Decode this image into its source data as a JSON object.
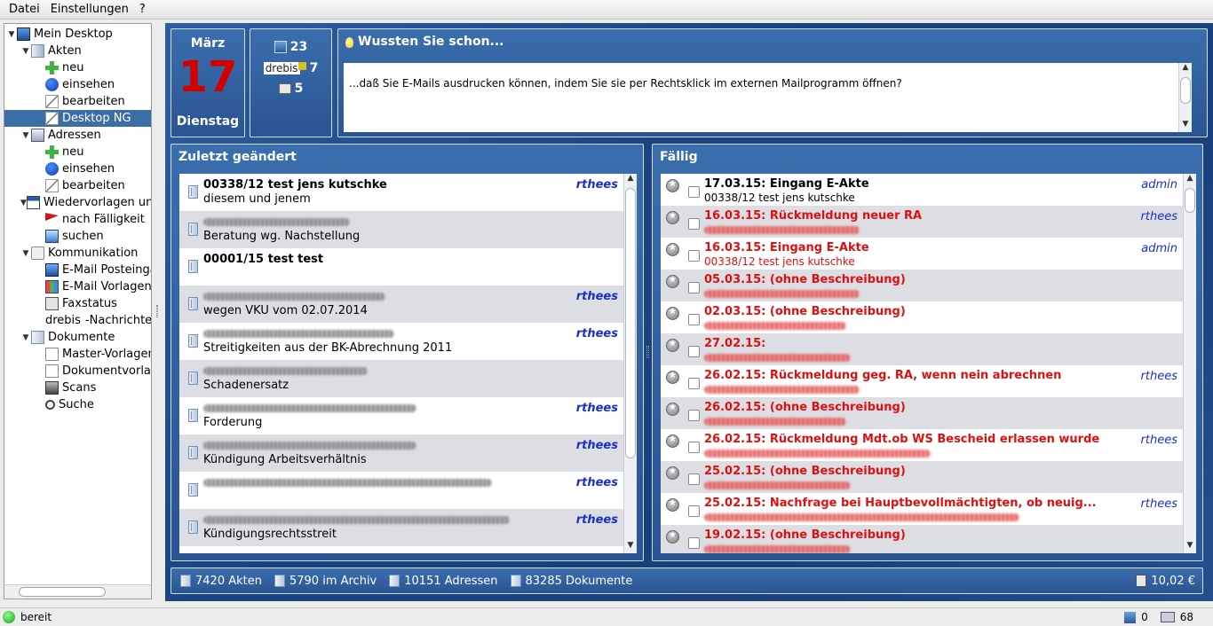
{
  "menu": {
    "items": [
      "Datei",
      "Einstellungen",
      "?"
    ]
  },
  "tree": {
    "items": [
      {
        "label": "Mein Desktop",
        "level": 0,
        "expanded": true,
        "icon": "desktop-icon"
      },
      {
        "label": "Akten",
        "level": 1,
        "expanded": true,
        "icon": "files-icon"
      },
      {
        "label": "neu",
        "level": 2,
        "icon": "add-icon"
      },
      {
        "label": "einsehen",
        "level": 2,
        "icon": "info-icon"
      },
      {
        "label": "bearbeiten",
        "level": 2,
        "icon": "edit-icon"
      },
      {
        "label": "Desktop NG",
        "level": 2,
        "icon": "edit-icon",
        "selected": true
      },
      {
        "label": "Adressen",
        "level": 1,
        "expanded": true,
        "icon": "address-icon"
      },
      {
        "label": "neu",
        "level": 2,
        "icon": "add-icon"
      },
      {
        "label": "einsehen",
        "level": 2,
        "icon": "info-icon"
      },
      {
        "label": "bearbeiten",
        "level": 2,
        "icon": "edit-icon"
      },
      {
        "label": "Wiedervorlagen und",
        "level": 1,
        "expanded": true,
        "icon": "calendar-icon"
      },
      {
        "label": "nach Fälligkeit",
        "level": 2,
        "icon": "flag-icon"
      },
      {
        "label": "suchen",
        "level": 2,
        "icon": "mail-search-icon"
      },
      {
        "label": "Kommunikation",
        "level": 1,
        "expanded": true,
        "icon": "communication-icon"
      },
      {
        "label": "E-Mail Posteingang",
        "level": 2,
        "icon": "mail-inbox-icon"
      },
      {
        "label": "E-Mail Vorlagen",
        "level": 2,
        "icon": "mail-template-icon"
      },
      {
        "label": "Faxstatus",
        "level": 2,
        "icon": "printer-icon"
      },
      {
        "label": "drebis",
        "suffix": "-Nachrichten",
        "level": 2,
        "icon": "drebis-icon"
      },
      {
        "label": "Dokumente",
        "level": 1,
        "expanded": true,
        "icon": "documents-icon"
      },
      {
        "label": "Master-Vorlagen",
        "level": 2,
        "icon": "document-icon"
      },
      {
        "label": "Dokumentvorlagen",
        "level": 2,
        "icon": "document-icon"
      },
      {
        "label": "Scans",
        "level": 2,
        "icon": "scanner-icon"
      },
      {
        "label": "Suche",
        "level": 2,
        "icon": "search-icon"
      }
    ]
  },
  "date": {
    "month": "März",
    "day": "17",
    "weekday": "Dienstag"
  },
  "counts": {
    "inbox": "23",
    "drebis_label": "drebis",
    "drebis": "7",
    "print": "5"
  },
  "tip": {
    "title": "Wussten Sie schon...",
    "text": "...daß Sie E-Mails ausdrucken können, indem Sie sie per Rechtsklick im externen Mailprogramm öffnen?"
  },
  "recent": {
    "title": "Zuletzt geändert",
    "rows": [
      {
        "title": "00338/12 test jens kutschke",
        "subtitle": "diesem und jenem",
        "user": "rthees",
        "title_blurred": false,
        "title_blur_width": 0
      },
      {
        "title": "",
        "subtitle": "Beratung wg. Nachstellung",
        "user": "",
        "title_blurred": true,
        "title_blur_width": 165
      },
      {
        "title": "00001/15 test test",
        "subtitle": "",
        "user": "",
        "title_blurred": false,
        "title_blur_width": 0
      },
      {
        "title": "",
        "subtitle": "wegen VKU vom 02.07.2014",
        "user": "rthees",
        "title_blurred": true,
        "title_blur_width": 205
      },
      {
        "title": "",
        "subtitle": "Streitigkeiten aus der BK-Abrechnung 2011",
        "user": "rthees",
        "title_blurred": true,
        "title_blur_width": 215
      },
      {
        "title": "",
        "subtitle": "Schadenersatz",
        "user": "",
        "title_blurred": true,
        "title_blur_width": 185
      },
      {
        "title": "",
        "subtitle": "Forderung",
        "user": "rthees",
        "title_blurred": true,
        "title_blur_width": 240
      },
      {
        "title": "",
        "subtitle": "Kündigung Arbeitsverhältnis",
        "user": "rthees",
        "title_blurred": true,
        "title_blur_width": 240
      },
      {
        "title": "",
        "subtitle": "",
        "user": "rthees",
        "title_blurred": true,
        "title_blur_width": 325
      },
      {
        "title": "",
        "subtitle": "Kündigungsrechtsstreit",
        "user": "rthees",
        "title_blurred": true,
        "title_blur_width": 345
      }
    ]
  },
  "due": {
    "title": "Fällig",
    "rows": [
      {
        "title": "17.03.15: Eingang E-Akte",
        "subtitle": "00338/12 test jens kutschke",
        "user": "admin",
        "red": false,
        "subtitle_blurred": false,
        "blur_width": 0
      },
      {
        "title": "16.03.15: Rückmeldung neuer RA",
        "subtitle": "",
        "user": "rthees",
        "red": true,
        "subtitle_blurred": true,
        "blur_width": 175
      },
      {
        "title": "16.03.15: Eingang E-Akte",
        "subtitle": "00338/12 test jens kutschke",
        "user": "admin",
        "red": true,
        "subtitle_blurred": false,
        "blur_width": 0
      },
      {
        "title": "05.03.15: (ohne Beschreibung)",
        "subtitle": "",
        "user": "",
        "red": true,
        "subtitle_blurred": true,
        "blur_width": 175
      },
      {
        "title": "02.03.15: (ohne Beschreibung)",
        "subtitle": "",
        "user": "",
        "red": true,
        "subtitle_blurred": true,
        "blur_width": 160
      },
      {
        "title": "27.02.15:",
        "subtitle": "",
        "user": "",
        "red": true,
        "subtitle_blurred": true,
        "blur_width": 165
      },
      {
        "title": "26.02.15: Rückmeldung geg. RA, wenn nein abrechnen",
        "subtitle": "",
        "user": "rthees",
        "red": true,
        "subtitle_blurred": true,
        "blur_width": 175
      },
      {
        "title": "26.02.15: (ohne Beschreibung)",
        "subtitle": "",
        "user": "",
        "red": true,
        "subtitle_blurred": true,
        "blur_width": 160
      },
      {
        "title": "26.02.15: Rückmeldung Mdt.ob WS Bescheid erlassen wurde",
        "subtitle": "",
        "user": "rthees",
        "red": true,
        "subtitle_blurred": true,
        "blur_width": 255
      },
      {
        "title": "25.02.15: (ohne Beschreibung)",
        "subtitle": "",
        "user": "",
        "red": true,
        "subtitle_blurred": true,
        "blur_width": 165
      },
      {
        "title": "25.02.15: Nachfrage bei Hauptbevollmächtigten, ob neuig...",
        "subtitle": "",
        "user": "rthees",
        "red": true,
        "subtitle_blurred": true,
        "blur_width": 355
      },
      {
        "title": "19.02.15: (ohne Beschreibung)",
        "subtitle": "",
        "user": "",
        "red": true,
        "subtitle_blurred": true,
        "blur_width": 165
      }
    ]
  },
  "footer": {
    "akten": "7420 Akten",
    "archiv": "5790 im Archiv",
    "adressen": "10151 Adressen",
    "dokumente": "83285 Dokumente",
    "cost": "10,02 €"
  },
  "status": {
    "text": "bereit",
    "inbox": "0",
    "count": "68"
  },
  "colors": {
    "accent": "#2a5493",
    "selection": "#3a6ea5",
    "overdue": "#e01010",
    "user": "#1a2fc8"
  }
}
